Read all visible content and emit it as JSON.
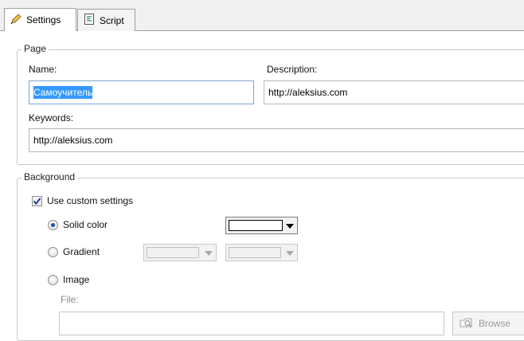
{
  "tabs": [
    {
      "label": "Settings",
      "icon": "pencil-icon",
      "active": true
    },
    {
      "label": "Script",
      "icon": "script-icon",
      "active": false
    }
  ],
  "page": {
    "legend": "Page",
    "name_label": "Name:",
    "name_value": "Самоучитель",
    "description_label": "Description:",
    "description_value": "http://aleksius.com",
    "keywords_label": "Keywords:",
    "keywords_value": "http://aleksius.com"
  },
  "background": {
    "legend": "Background",
    "custom_label": "Use custom settings",
    "custom_checked": true,
    "options": [
      {
        "label": "Solid color",
        "selected": true
      },
      {
        "label": "Gradient",
        "selected": false
      },
      {
        "label": "Image",
        "selected": false
      }
    ],
    "solid_color": "#ffffff",
    "file_label": "File:",
    "file_value": "",
    "browse_label": "Browse"
  },
  "colors": {
    "accent": "#3399ff",
    "focus_border": "#7da2ce",
    "radio_dot": "#1a4f9a"
  }
}
